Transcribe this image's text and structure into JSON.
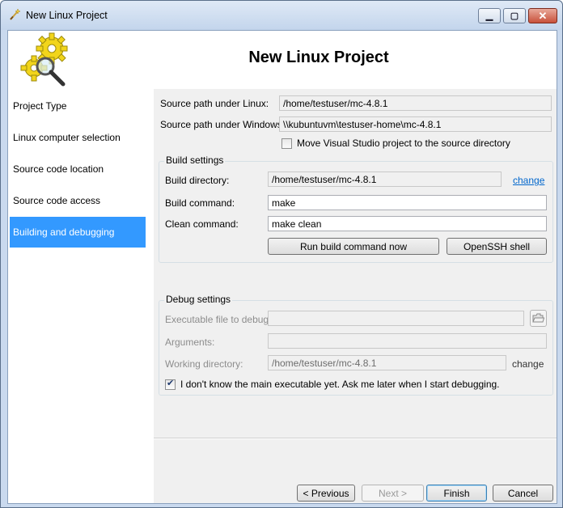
{
  "window": {
    "title": "New Linux Project"
  },
  "header": {
    "title": "New Linux Project"
  },
  "sidebar": {
    "items": [
      {
        "label": "Project Type"
      },
      {
        "label": "Linux computer selection"
      },
      {
        "label": "Source code location"
      },
      {
        "label": "Source code access"
      },
      {
        "label": "Building and debugging",
        "active": true
      }
    ]
  },
  "paths": {
    "linux_label": "Source path under Linux:",
    "linux_value": "/home/testuser/mc-4.8.1",
    "windows_label": "Source path under Windows:",
    "windows_value": "\\\\kubuntuvm\\testuser-home\\mc-4.8.1",
    "move_label": "Move Visual Studio project to the source directory",
    "move_checked": false
  },
  "build": {
    "group_title": "Build settings",
    "dir_label": "Build directory:",
    "dir_value": "/home/testuser/mc-4.8.1",
    "dir_change": "change",
    "cmd_label": "Build command:",
    "cmd_value": "make",
    "clean_label": "Clean command:",
    "clean_value": "make clean",
    "run_button": "Run build command now",
    "ssh_button": "OpenSSH shell"
  },
  "debug": {
    "group_title": "Debug settings",
    "exe_label": "Executable file to debug:",
    "exe_value": "",
    "args_label": "Arguments:",
    "args_value": "",
    "wd_label": "Working directory:",
    "wd_value": "/home/testuser/mc-4.8.1",
    "wd_change": "change",
    "dontknow_label": "I don't know the main executable yet. Ask me later when I start debugging.",
    "dontknow_checked": true
  },
  "footer": {
    "previous": "< Previous",
    "next": "Next >",
    "finish": "Finish",
    "cancel": "Cancel"
  },
  "colors": {
    "selection": "#3399ff",
    "link": "#0066cc",
    "panel": "#f0f0f0"
  },
  "icons": {
    "title": "wizard-wand-icon",
    "logo": "gears-magnifier-icon",
    "browse": "folder-open-icon"
  }
}
